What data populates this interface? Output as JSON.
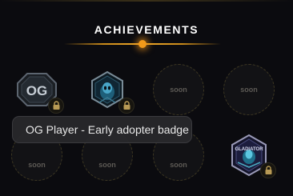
{
  "header": {
    "title": "ACHIEVEMENTS"
  },
  "slots": [
    {
      "kind": "badge",
      "icon": "og-badge-icon",
      "locked": true
    },
    {
      "kind": "badge",
      "icon": "alien-hexagon-badge-icon",
      "locked": true
    },
    {
      "kind": "soon",
      "label": "soon"
    },
    {
      "kind": "soon",
      "label": "soon"
    },
    {
      "kind": "soon",
      "label": "soon"
    },
    {
      "kind": "soon",
      "label": "soon"
    },
    {
      "kind": "soon",
      "label": "soon"
    },
    {
      "kind": "badge",
      "icon": "gladiator-badge-icon",
      "locked": true
    }
  ],
  "badges": {
    "og": {
      "text": "OG"
    },
    "gladiator": {
      "text": "GLADIATOR"
    }
  },
  "tooltip": {
    "text": "OG Player - Early adopter badge"
  },
  "colors": {
    "accent": "#f39a1a",
    "background": "#0b0b0f",
    "soon_text": "#5d5a55"
  }
}
